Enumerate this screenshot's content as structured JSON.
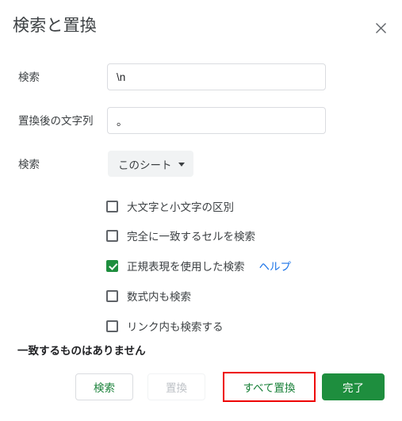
{
  "dialog": {
    "title": "検索と置換",
    "close_icon": "close-icon"
  },
  "fields": {
    "search": {
      "label": "検索",
      "value": "\\n",
      "placeholder": ""
    },
    "replace": {
      "label": "置換後の文字列",
      "value": "。",
      "placeholder": ""
    },
    "scope": {
      "label": "検索",
      "selected": "このシート",
      "caret_icon": "chevron-down-icon"
    }
  },
  "options": [
    {
      "label": "大文字と小文字の区別",
      "checked": false
    },
    {
      "label": "完全に一致するセルを検索",
      "checked": false
    },
    {
      "label": "正規表現を使用した検索",
      "checked": true,
      "help_label": "ヘルプ"
    },
    {
      "label": "数式内も検索",
      "checked": false
    },
    {
      "label": "リンク内も検索する",
      "checked": false
    }
  ],
  "status": {
    "message": "一致するものはありません"
  },
  "footer": {
    "find_label": "検索",
    "replace_label": "置換",
    "replace_all_label": "すべて置換",
    "done_label": "完了"
  },
  "colors": {
    "accent_green": "#1e8e3e",
    "text_green": "#188038",
    "link_blue": "#1a73e8",
    "highlight_red": "#ee0000",
    "disabled_gray": "#bdc1c6",
    "border_gray": "#dadce0",
    "chip_bg": "#f1f3f4",
    "text_primary": "#3c4043"
  }
}
